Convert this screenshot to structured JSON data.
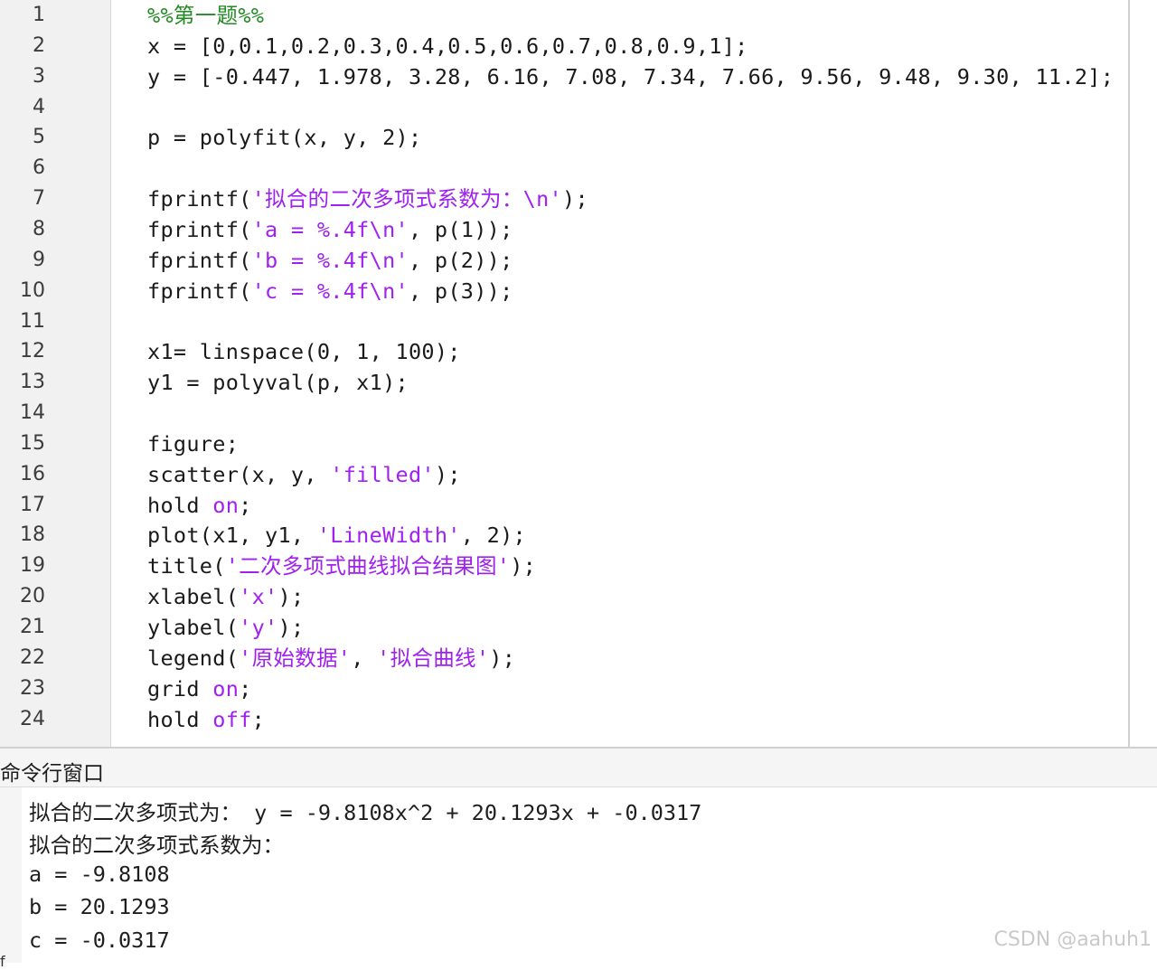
{
  "editor": {
    "lines": [
      {
        "n": "1",
        "segs": [
          {
            "t": "%%",
            "c": "cmt"
          },
          {
            "t": "第一题",
            "c": "cmt cjk"
          },
          {
            "t": "%%",
            "c": "cmt"
          }
        ]
      },
      {
        "n": "2",
        "segs": [
          {
            "t": "x = [0,0.1,0.2,0.3,0.4,0.5,0.6,0.7,0.8,0.9,1];",
            "c": ""
          }
        ]
      },
      {
        "n": "3",
        "segs": [
          {
            "t": "y = [-0.447, 1.978, 3.28, 6.16, 7.08, 7.34, 7.66, 9.56, 9.48, 9.30, 11.2];",
            "c": ""
          }
        ]
      },
      {
        "n": "4",
        "segs": []
      },
      {
        "n": "5",
        "segs": [
          {
            "t": "p = polyfit(x, y, 2);",
            "c": ""
          }
        ]
      },
      {
        "n": "6",
        "segs": []
      },
      {
        "n": "7",
        "segs": [
          {
            "t": "fprintf(",
            "c": ""
          },
          {
            "t": "'",
            "c": "str"
          },
          {
            "t": "拟合的二次多项式系数为：",
            "c": "str cjk"
          },
          {
            "t": "\\n'",
            "c": "str"
          },
          {
            "t": ");",
            "c": ""
          }
        ]
      },
      {
        "n": "8",
        "segs": [
          {
            "t": "fprintf(",
            "c": ""
          },
          {
            "t": "'a = %.4f\\n'",
            "c": "str"
          },
          {
            "t": ", p(1));",
            "c": ""
          }
        ]
      },
      {
        "n": "9",
        "segs": [
          {
            "t": "fprintf(",
            "c": ""
          },
          {
            "t": "'b = %.4f\\n'",
            "c": "str"
          },
          {
            "t": ", p(2));",
            "c": ""
          }
        ]
      },
      {
        "n": "10",
        "segs": [
          {
            "t": "fprintf(",
            "c": ""
          },
          {
            "t": "'c = %.4f\\n'",
            "c": "str"
          },
          {
            "t": ", p(3));",
            "c": ""
          }
        ]
      },
      {
        "n": "11",
        "segs": []
      },
      {
        "n": "12",
        "segs": [
          {
            "t": "x1= linspace(0, 1, 100);",
            "c": ""
          }
        ]
      },
      {
        "n": "13",
        "segs": [
          {
            "t": "y1 = polyval(p, x1);",
            "c": ""
          }
        ]
      },
      {
        "n": "14",
        "segs": []
      },
      {
        "n": "15",
        "segs": [
          {
            "t": "figure;",
            "c": ""
          }
        ]
      },
      {
        "n": "16",
        "segs": [
          {
            "t": "scatter(x, y, ",
            "c": ""
          },
          {
            "t": "'filled'",
            "c": "str"
          },
          {
            "t": ");",
            "c": ""
          }
        ]
      },
      {
        "n": "17",
        "segs": [
          {
            "t": "hold ",
            "c": ""
          },
          {
            "t": "on",
            "c": "str"
          },
          {
            "t": ";",
            "c": ""
          }
        ]
      },
      {
        "n": "18",
        "segs": [
          {
            "t": "plot(x1, y1, ",
            "c": ""
          },
          {
            "t": "'LineWidth'",
            "c": "str"
          },
          {
            "t": ", 2);",
            "c": ""
          }
        ]
      },
      {
        "n": "19",
        "segs": [
          {
            "t": "title(",
            "c": ""
          },
          {
            "t": "'",
            "c": "str"
          },
          {
            "t": "二次多项式曲线拟合结果图",
            "c": "str cjk"
          },
          {
            "t": "'",
            "c": "str"
          },
          {
            "t": ");",
            "c": ""
          }
        ]
      },
      {
        "n": "20",
        "segs": [
          {
            "t": "xlabel(",
            "c": ""
          },
          {
            "t": "'x'",
            "c": "str"
          },
          {
            "t": ");",
            "c": ""
          }
        ]
      },
      {
        "n": "21",
        "segs": [
          {
            "t": "ylabel(",
            "c": ""
          },
          {
            "t": "'y'",
            "c": "str"
          },
          {
            "t": ");",
            "c": ""
          }
        ]
      },
      {
        "n": "22",
        "segs": [
          {
            "t": "legend(",
            "c": ""
          },
          {
            "t": "'",
            "c": "str"
          },
          {
            "t": "原始数据",
            "c": "str cjk"
          },
          {
            "t": "'",
            "c": "str"
          },
          {
            "t": ", ",
            "c": ""
          },
          {
            "t": "'",
            "c": "str"
          },
          {
            "t": "拟合曲线",
            "c": "str cjk"
          },
          {
            "t": "'",
            "c": "str"
          },
          {
            "t": ");",
            "c": ""
          }
        ]
      },
      {
        "n": "23",
        "segs": [
          {
            "t": "grid ",
            "c": ""
          },
          {
            "t": "on",
            "c": "str"
          },
          {
            "t": ";",
            "c": ""
          }
        ]
      },
      {
        "n": "24",
        "segs": [
          {
            "t": "hold ",
            "c": ""
          },
          {
            "t": "off",
            "c": "str"
          },
          {
            "t": ";",
            "c": ""
          }
        ]
      }
    ]
  },
  "command_window": {
    "title": "命令行窗口",
    "output": [
      {
        "segs": [
          {
            "t": "拟合的二次多项式为：",
            "c": "cjk"
          },
          {
            "t": " y = -9.8108x^2 + 20.1293x + -0.0317",
            "c": ""
          }
        ]
      },
      {
        "segs": [
          {
            "t": "拟合的二次多项式系数为：",
            "c": "cjk"
          }
        ]
      },
      {
        "segs": [
          {
            "t": "a = -9.8108",
            "c": ""
          }
        ]
      },
      {
        "segs": [
          {
            "t": "b = 20.1293",
            "c": ""
          }
        ]
      },
      {
        "segs": [
          {
            "t": "c = -0.0317",
            "c": ""
          }
        ]
      }
    ],
    "prompt_glyph": "f"
  },
  "watermark": "CSDN @aahuh1",
  "colors": {
    "string": "#a020f0",
    "comment": "#228b22",
    "text": "#1a1a1a",
    "gutter": "#f1f1f1"
  }
}
